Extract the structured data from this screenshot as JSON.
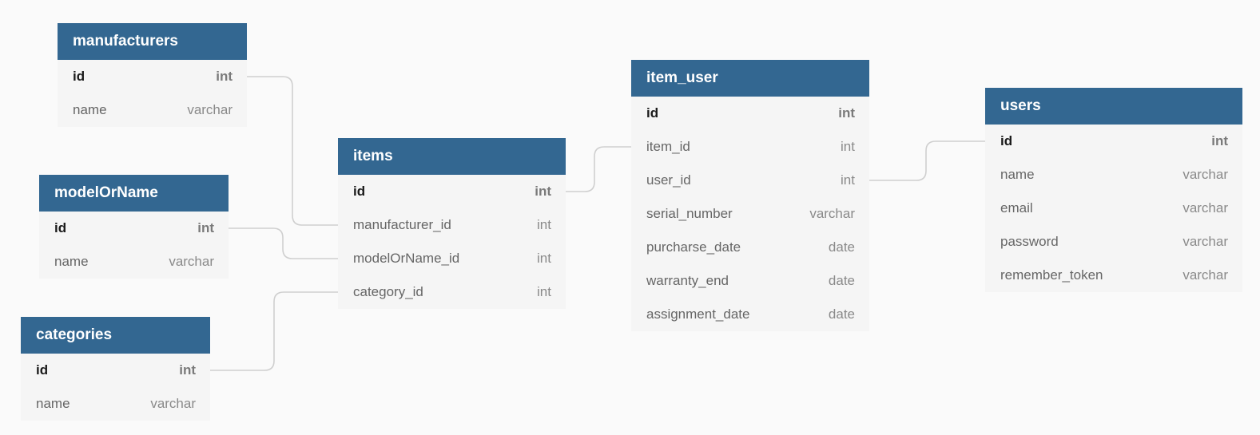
{
  "diagram": {
    "tables": [
      {
        "id": "manufacturers",
        "name": "manufacturers",
        "fields": [
          {
            "name": "id",
            "type": "int",
            "pk": true
          },
          {
            "name": "name",
            "type": "varchar",
            "pk": false
          }
        ]
      },
      {
        "id": "modelOrName",
        "name": "modelOrName",
        "fields": [
          {
            "name": "id",
            "type": "int",
            "pk": true
          },
          {
            "name": "name",
            "type": "varchar",
            "pk": false
          }
        ]
      },
      {
        "id": "categories",
        "name": "categories",
        "fields": [
          {
            "name": "id",
            "type": "int",
            "pk": true
          },
          {
            "name": "name",
            "type": "varchar",
            "pk": false
          }
        ]
      },
      {
        "id": "items",
        "name": "items",
        "fields": [
          {
            "name": "id",
            "type": "int",
            "pk": true
          },
          {
            "name": "manufacturer_id",
            "type": "int",
            "pk": false
          },
          {
            "name": "modelOrName_id",
            "type": "int",
            "pk": false
          },
          {
            "name": "category_id",
            "type": "int",
            "pk": false
          }
        ]
      },
      {
        "id": "item_user",
        "name": "item_user",
        "fields": [
          {
            "name": "id",
            "type": "int",
            "pk": true
          },
          {
            "name": "item_id",
            "type": "int",
            "pk": false
          },
          {
            "name": "user_id",
            "type": "int",
            "pk": false
          },
          {
            "name": "serial_number",
            "type": "varchar",
            "pk": false
          },
          {
            "name": "purcharse_date",
            "type": "date",
            "pk": false
          },
          {
            "name": "warranty_end",
            "type": "date",
            "pk": false
          },
          {
            "name": "assignment_date",
            "type": "date",
            "pk": false
          }
        ]
      },
      {
        "id": "users",
        "name": "users",
        "fields": [
          {
            "name": "id",
            "type": "int",
            "pk": true
          },
          {
            "name": "name",
            "type": "varchar",
            "pk": false
          },
          {
            "name": "email",
            "type": "varchar",
            "pk": false
          },
          {
            "name": "password",
            "type": "varchar",
            "pk": false
          },
          {
            "name": "remember_token",
            "type": "varchar",
            "pk": false
          }
        ]
      }
    ],
    "relations": [
      {
        "from": "manufacturers.id",
        "to": "items.manufacturer_id"
      },
      {
        "from": "modelOrName.id",
        "to": "items.modelOrName_id"
      },
      {
        "from": "categories.id",
        "to": "items.category_id"
      },
      {
        "from": "items.id",
        "to": "item_user.item_id"
      },
      {
        "from": "item_user.user_id",
        "to": "users.id"
      }
    ]
  }
}
